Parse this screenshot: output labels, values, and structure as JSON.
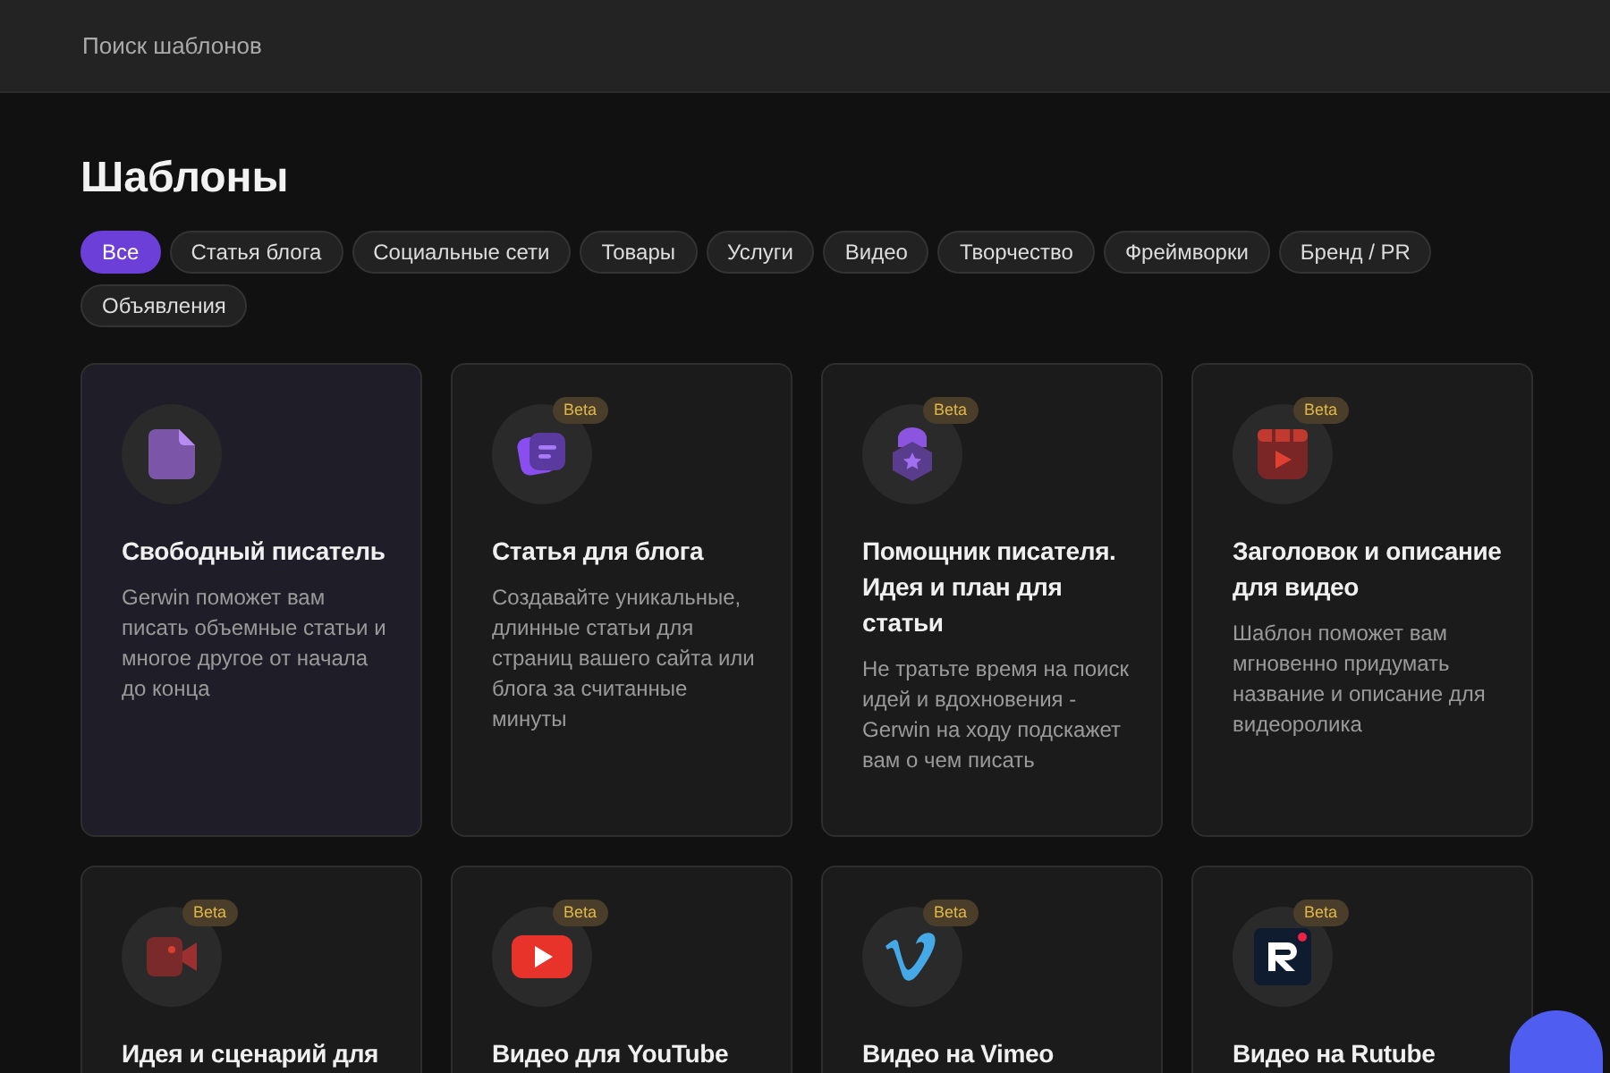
{
  "search": {
    "placeholder": "Поиск шаблонов"
  },
  "title": "Шаблоны",
  "filters": [
    {
      "label": "Все",
      "selected": true
    },
    {
      "label": "Статья блога",
      "selected": false
    },
    {
      "label": "Социальные сети",
      "selected": false
    },
    {
      "label": "Товары",
      "selected": false
    },
    {
      "label": "Услуги",
      "selected": false
    },
    {
      "label": "Видео",
      "selected": false
    },
    {
      "label": "Творчество",
      "selected": false
    },
    {
      "label": "Фреймворки",
      "selected": false
    },
    {
      "label": "Бренд / PR",
      "selected": false
    },
    {
      "label": "Объявления",
      "selected": false
    }
  ],
  "cards": [
    {
      "kind": "document",
      "title": "Свободный писатель",
      "description": "Gerwin поможет вам писать объемные статьи и многое другое от начала до конца",
      "highlighted": true
    },
    {
      "kind": "blog",
      "badge": "Beta",
      "title": "Статья для блога",
      "description": "Создавайте уникальные, длинные статьи для страниц вашего сайта или блога за считанные минуты",
      "highlighted": false
    },
    {
      "kind": "lock",
      "badge": "Beta",
      "title": "Помощник писателя. Идея и план для статьи",
      "description": "Не тратьте время на поиск идей и вдохновения - Gerwin на ходу подскажет вам о чем писать",
      "highlighted": false
    },
    {
      "kind": "video-calendar",
      "badge": "Beta",
      "title": "Заголовок и описание для видео",
      "description": "Шаблон поможет вам мгновенно придумать название и описание для видеоролика",
      "highlighted": false
    },
    {
      "kind": "camera",
      "badge": "Beta",
      "title": "Идея и сценарий для",
      "highlighted": false
    },
    {
      "kind": "youtube",
      "badge": "Beta",
      "title": "Видео для YouTube",
      "highlighted": false
    },
    {
      "kind": "vimeo",
      "badge": "Beta",
      "title": "Видео на Vimeo",
      "highlighted": false
    },
    {
      "kind": "rutube",
      "badge": "Beta",
      "title": "Видео на Rutube",
      "highlighted": false
    }
  ]
}
